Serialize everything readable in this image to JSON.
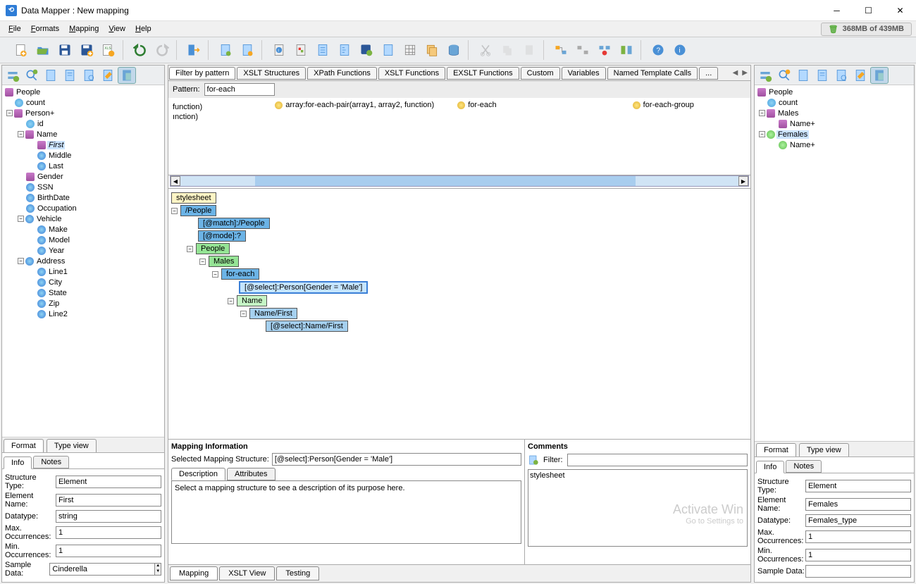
{
  "window": {
    "title": "Data Mapper : New mapping"
  },
  "menu": {
    "file": "File",
    "formats": "Formats",
    "mapping": "Mapping",
    "view": "View",
    "help": "Help"
  },
  "memory": {
    "status": "368MB of 439MB"
  },
  "leftTree": {
    "root": "People",
    "count": "count",
    "person": "Person+",
    "id": "id",
    "name": "Name",
    "first": "First",
    "middle": "Middle",
    "last": "Last",
    "gender": "Gender",
    "ssn": "SSN",
    "birthdate": "BirthDate",
    "occupation": "Occupation",
    "vehicle": "Vehicle",
    "make": "Make",
    "model": "Model",
    "year": "Year",
    "address": "Address",
    "line1": "Line1",
    "city": "City",
    "state": "State",
    "zip": "Zip",
    "line2": "Line2"
  },
  "rightTree": {
    "root": "People",
    "count": "count",
    "males": "Males",
    "name1": "Name+",
    "females": "Females",
    "name2": "Name+"
  },
  "bottomTabs": {
    "format": "Format",
    "typeview": "Type view"
  },
  "infoTabs": {
    "info": "Info",
    "notes": "Notes"
  },
  "leftInfo": {
    "structTypeL": "Structure Type:",
    "structTypeV": "Element",
    "elemNameL": "Element Name:",
    "elemNameV": "First",
    "dtypeL": "Datatype:",
    "dtypeV": "string",
    "maxOccL": "Max. Occurrences:",
    "maxOccV": "1",
    "minOccL": "Min. Occurrences:",
    "minOccV": "1",
    "sampleL": "Sample Data:",
    "sampleV": "Cinderella"
  },
  "rightInfo": {
    "structTypeL": "Structure Type:",
    "structTypeV": "Element",
    "elemNameL": "Element Name:",
    "elemNameV": "Females",
    "dtypeL": "Datatype:",
    "dtypeV": "Females_type",
    "maxOccL": "Max. Occurrences:",
    "maxOccV": "1",
    "minOccL": "Min. Occurrences:",
    "minOccV": "1",
    "sampleL": "Sample Data:",
    "sampleV": ""
  },
  "funcTabs": {
    "filter": "Filter by pattern",
    "xsltStruct": "XSLT Structures",
    "xpath": "XPath Functions",
    "xsltFunc": "XSLT Functions",
    "exslt": "EXSLT Functions",
    "custom": "Custom",
    "vars": "Variables",
    "named": "Named Template Calls",
    "more": "..."
  },
  "pattern": {
    "label": "Pattern:",
    "value": "for-each"
  },
  "funcResults": {
    "r1a": "function)",
    "r1b": "array:for-each-pair(array1, array2, function)",
    "r1c": "for-each",
    "r1d": "for-each-group",
    "r2a": "ınction)"
  },
  "mapTree": {
    "stylesheet": "stylesheet",
    "people": "/People",
    "match": "[@match]:/People",
    "mode": "[@mode]:?",
    "peopleEl": "People",
    "males": "Males",
    "foreach": "for-each",
    "select": "[@select]:Person[Gender = 'Male']",
    "name": "Name",
    "nameFirst": "Name/First",
    "selectNF": "[@select]:Name/First"
  },
  "mapInfo": {
    "title": "Mapping Information",
    "selLabel": "Selected Mapping Structure:",
    "selVal": "[@select]:Person[Gender = 'Male']",
    "descTab": "Description",
    "attrTab": "Attributes",
    "descText": "Select a mapping structure to see a description of its purpose here."
  },
  "comments": {
    "title": "Comments",
    "filterL": "Filter:",
    "item1": "stylesheet"
  },
  "centerBTabs": {
    "mapping": "Mapping",
    "xslt": "XSLT View",
    "testing": "Testing"
  },
  "watermark": {
    "line1": "Activate Win",
    "line2": "Go to Settings to"
  }
}
